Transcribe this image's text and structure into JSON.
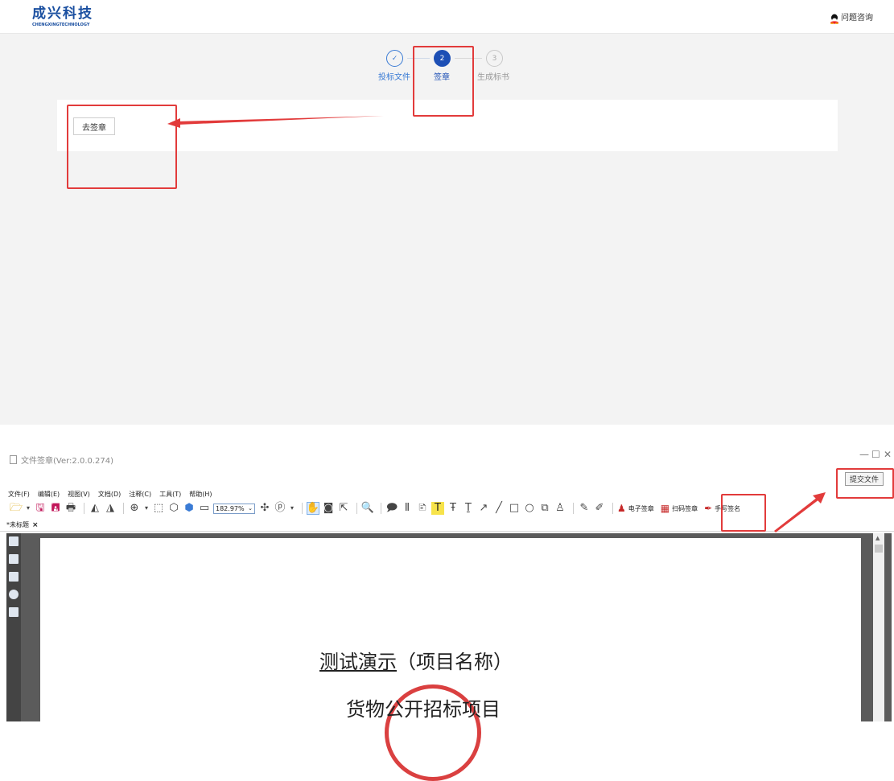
{
  "web": {
    "logo": {
      "main": "成兴科技",
      "sub": "CHENGXINGTECHNOLOGY"
    },
    "help_label": "问题咨询",
    "steps": [
      {
        "label": "投标文件",
        "marker": "✓",
        "state": "done"
      },
      {
        "label": "签章",
        "marker": "2",
        "state": "active"
      },
      {
        "label": "生成标书",
        "marker": "3",
        "state": "pending"
      }
    ],
    "sign_button": "去签章"
  },
  "app": {
    "title": "文件签章(Ver:2.0.0.274)",
    "submit_button": "提交文件",
    "menu": [
      "文件(F)",
      "编辑(E)",
      "视图(V)",
      "文档(D)",
      "注释(C)",
      "工具(T)",
      "帮助(H)"
    ],
    "zoom": "182.97%",
    "sign_tools": {
      "electronic": "电子签章",
      "qr": "扫码签章",
      "handwritten": "手写签名"
    },
    "tab_name": "*未标题",
    "document": {
      "line1_underlined": "测试演示",
      "line1_rest": "（项目名称）",
      "line2": "货物公开招标项目"
    }
  },
  "colors": {
    "accent": "#1a4fa0",
    "annotation": "#e23b3b",
    "seal": "#d41f1f"
  }
}
